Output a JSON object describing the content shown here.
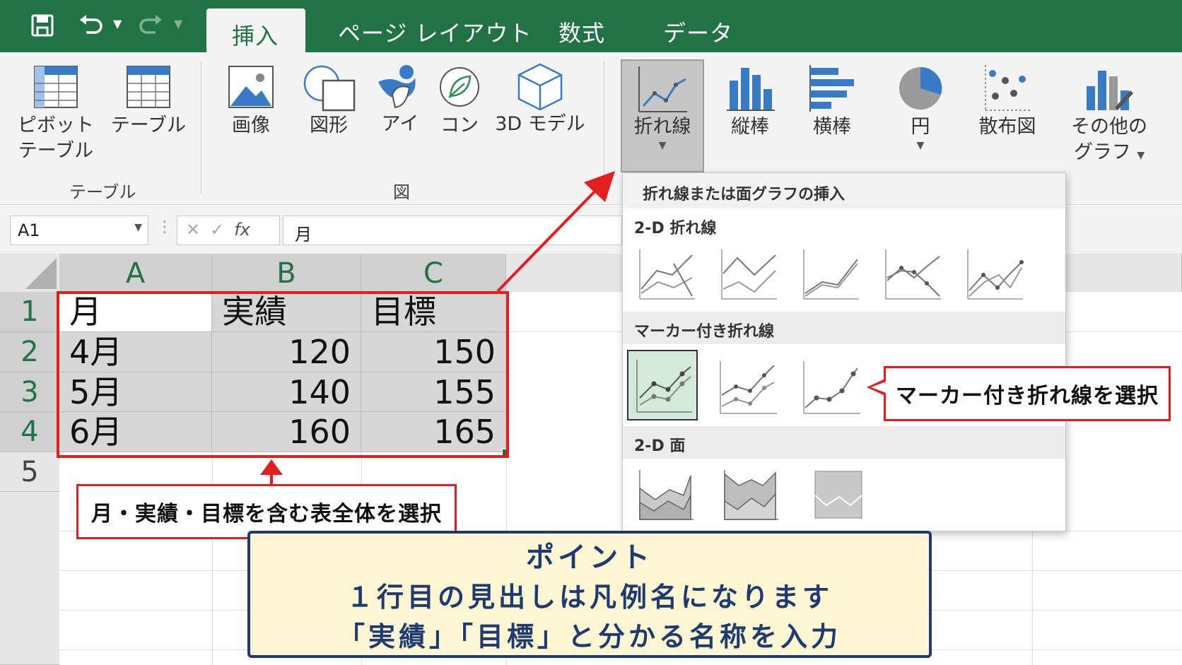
{
  "quick_access": {
    "save": "save-icon",
    "undo": "undo-icon",
    "redo": "redo-icon"
  },
  "tabs": [
    "挿入",
    "ページ レイアウト",
    "数式",
    "データ"
  ],
  "ribbon": {
    "table_group": {
      "label": "テーブル",
      "pivot_line1": "ピボット",
      "pivot_line2": "テーブル",
      "table": "テーブル"
    },
    "illustrations_group": {
      "label": "図",
      "image": "画像",
      "shapes": "図形",
      "icons": "アイ",
      "connect": "コン",
      "model3d": "3D モデル"
    },
    "charts_group": {
      "line": "折れ線",
      "column": "縦棒",
      "bar": "横棒",
      "pie": "円",
      "scatter": "散布図",
      "other_line1": "その他の",
      "other_line2": "グラフ"
    }
  },
  "formula_bar": {
    "name_box": "A1",
    "fx": "fx",
    "content": "月"
  },
  "sheet": {
    "columns": [
      "A",
      "B",
      "C"
    ],
    "rows": [
      "1",
      "2",
      "3",
      "4",
      "5"
    ],
    "cells": [
      [
        "月",
        "実績",
        "目標"
      ],
      [
        "4月",
        "120",
        "150"
      ],
      [
        "5月",
        "140",
        "155"
      ],
      [
        "6月",
        "160",
        "165"
      ]
    ]
  },
  "gallery": {
    "title": "折れ線または面グラフの挿入",
    "sec_2d_line": "2-D 折れ線",
    "sec_marker": "マーカー付き折れ線",
    "sec_2d_area": "2-D 面"
  },
  "callouts": {
    "select_table": "月・実績・目標を含む表全体を選択",
    "select_marker": "マーカー付き折れ線を選択",
    "point_title": "ポイント",
    "point_line1": "１行目の見出しは凡例名になります",
    "point_line2": "「実績」「目標」と分かる名称を入力"
  },
  "colors": {
    "excel_green": "#217346",
    "callout_red": "#e41e1e",
    "point_navy": "#1e3a6e",
    "point_bg": "#fdf6d3",
    "chart_blue": "#3a7bc8"
  }
}
